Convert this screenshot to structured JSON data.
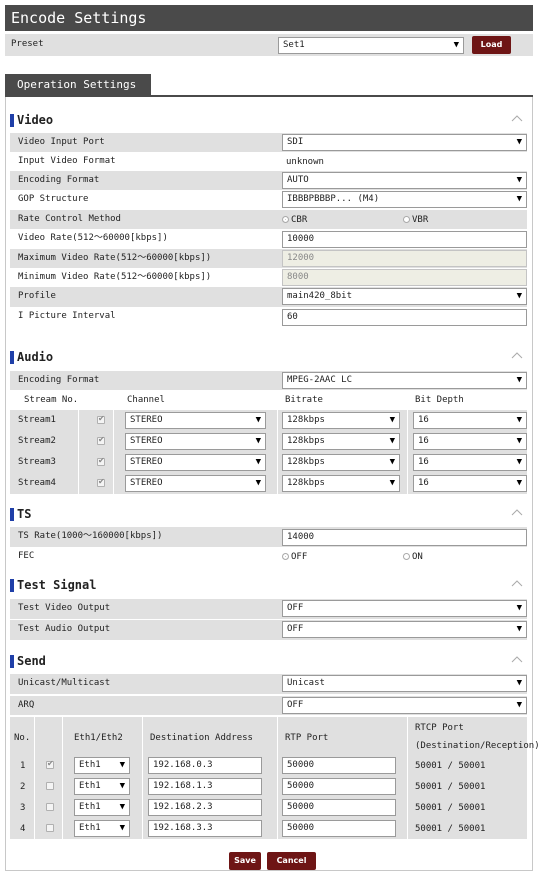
{
  "title": "Encode Settings",
  "preset": {
    "label": "Preset",
    "value": "Set1",
    "load_label": "Load"
  },
  "tab": "Operation Settings",
  "video": {
    "title": "Video",
    "rows": [
      {
        "label": "Video Input Port",
        "value": "SDI"
      },
      {
        "label": "Input Video Format",
        "value": "unknown"
      },
      {
        "label": "Encoding Format",
        "value": "AUTO"
      },
      {
        "label": "GOP Structure",
        "value": "IBBBPBBBP... (M4)"
      },
      {
        "label": "Rate Control Method",
        "opt1": "CBR",
        "opt2": "VBR"
      },
      {
        "label": "Video Rate(512～60000[kbps])",
        "value": "10000"
      },
      {
        "label": "Maximum Video Rate(512～60000[kbps])",
        "value": "12000"
      },
      {
        "label": "Minimum Video Rate(512～60000[kbps])",
        "value": "8000"
      },
      {
        "label": "Profile",
        "value": "main420_8bit"
      },
      {
        "label": "I Picture Interval",
        "value": "60"
      }
    ]
  },
  "audio": {
    "title": "Audio",
    "encoding_label": "Encoding Format",
    "encoding_value": "MPEG-2AAC LC",
    "headers": {
      "stream": "Stream No.",
      "channel": "Channel",
      "bitrate": "Bitrate",
      "bitdepth": "Bit Depth"
    },
    "streams": [
      {
        "name": "Stream1",
        "channel": "STEREO",
        "bitrate": "128kbps",
        "bitdepth": "16"
      },
      {
        "name": "Stream2",
        "channel": "STEREO",
        "bitrate": "128kbps",
        "bitdepth": "16"
      },
      {
        "name": "Stream3",
        "channel": "STEREO",
        "bitrate": "128kbps",
        "bitdepth": "16"
      },
      {
        "name": "Stream4",
        "channel": "STEREO",
        "bitrate": "128kbps",
        "bitdepth": "16"
      }
    ]
  },
  "ts": {
    "title": "TS",
    "rate_label": "TS Rate(1000～160000[kbps])",
    "rate_value": "14000",
    "fec_label": "FEC",
    "fec_opt1": "OFF",
    "fec_opt2": "ON"
  },
  "test": {
    "title": "Test Signal",
    "video_label": "Test Video Output",
    "video_value": "OFF",
    "audio_label": "Test Audio Output",
    "audio_value": "OFF"
  },
  "send": {
    "title": "Send",
    "mode_label": "Unicast/Multicast",
    "mode_value": "Unicast",
    "arq_label": "ARQ",
    "arq_value": "OFF",
    "headers": {
      "no": "No.",
      "eth": "Eth1/Eth2",
      "dest": "Destination Address",
      "rtp": "RTP Port",
      "rtcp1": "RTCP Port",
      "rtcp2": "(Destination/Reception)"
    },
    "rows": [
      {
        "no": "1",
        "eth": "Eth1",
        "dest": "192.168.0.3",
        "rtp": "50000",
        "rtcp": "50001 / 50001"
      },
      {
        "no": "2",
        "eth": "Eth1",
        "dest": "192.168.1.3",
        "rtp": "50000",
        "rtcp": "50001 / 50001"
      },
      {
        "no": "3",
        "eth": "Eth1",
        "dest": "192.168.2.3",
        "rtp": "50000",
        "rtcp": "50001 / 50001"
      },
      {
        "no": "4",
        "eth": "Eth1",
        "dest": "192.168.3.3",
        "rtp": "50000",
        "rtcp": "50001 / 50001"
      }
    ]
  },
  "buttons": {
    "save": "Save",
    "cancel": "Cancel"
  },
  "colors": {
    "header_bg": "#4a4a4a",
    "button_bg": "#6e1515",
    "accent": "#1f3fa8",
    "row_bg": "#e0e0e0"
  }
}
